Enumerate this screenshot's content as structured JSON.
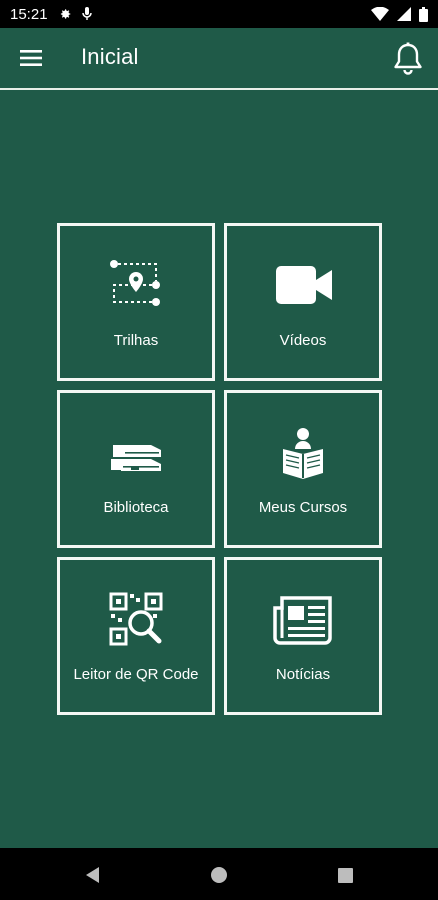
{
  "status": {
    "time": "15:21"
  },
  "appbar": {
    "title": "Inicial"
  },
  "tiles": [
    {
      "label": "Trilhas",
      "icon": "route-icon"
    },
    {
      "label": "Vídeos",
      "icon": "video-camera-icon"
    },
    {
      "label": "Biblioteca",
      "icon": "books-icon"
    },
    {
      "label": "Meus Cursos",
      "icon": "reader-icon"
    },
    {
      "label": "Leitor de QR Code",
      "icon": "qr-search-icon"
    },
    {
      "label": "Notícias",
      "icon": "newspaper-icon"
    }
  ],
  "colors": {
    "background": "#1f5a48",
    "border": "#f4f7f4",
    "system_bar": "#000000"
  }
}
